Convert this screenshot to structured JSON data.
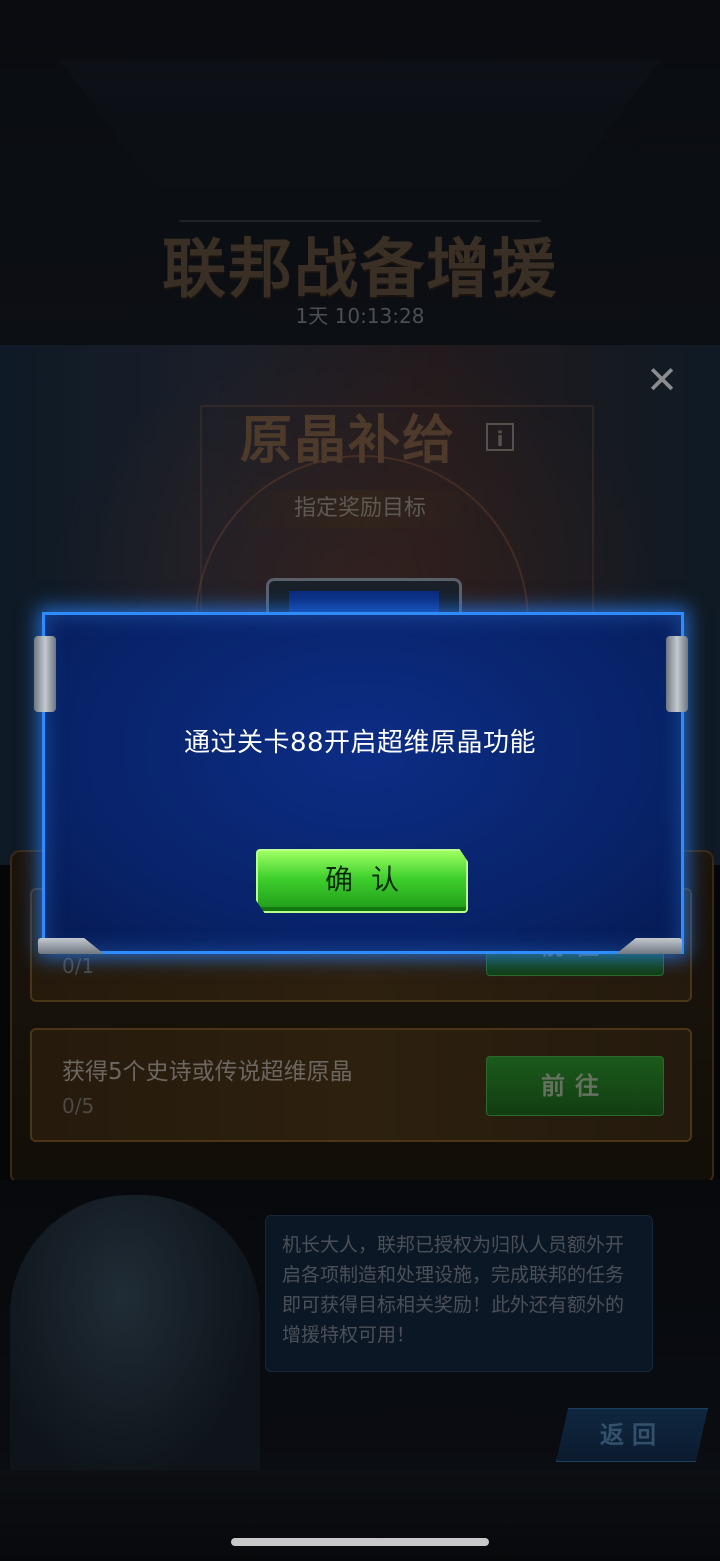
{
  "event": {
    "title": "联邦战备增援",
    "timer": "1天 10:13:28"
  },
  "crystal_panel": {
    "title": "原晶补给",
    "info_icon": "i",
    "reward_label": "指定奖励目标",
    "close_icon": "✕"
  },
  "tasks": [
    {
      "name": "",
      "progress": "0/1",
      "button": "前往"
    },
    {
      "name": "获得5个史诗或传说超维原晶",
      "progress": "0/5",
      "button": "前往"
    }
  ],
  "dialog": {
    "text": "机长大人，联邦已授权为归队人员额外开启各项制造和处理设施，完成联邦的任务即可获得目标相关奖励！此外还有额外的增援特权可用！"
  },
  "back_button": "返回",
  "modal": {
    "message": "通过关卡88开启超维原晶功能",
    "confirm_label": "确认"
  },
  "colors": {
    "modal_border": "#2f8cff",
    "modal_bg": "#0c2d86",
    "confirm_green": "#3fd02d"
  }
}
